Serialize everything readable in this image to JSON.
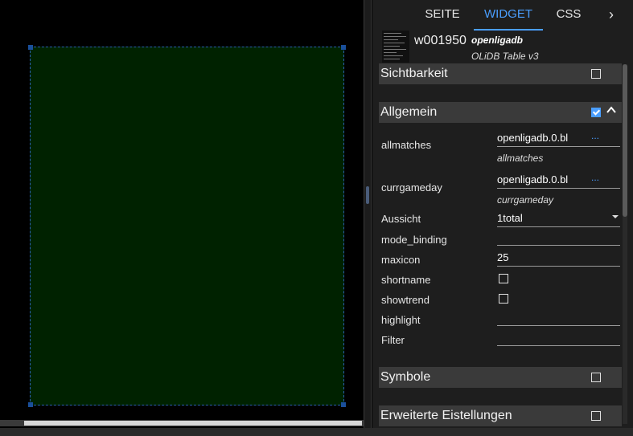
{
  "tabs": {
    "seite": "SEITE",
    "widget": "WIDGET",
    "css": "CSS",
    "next": "›"
  },
  "widget": {
    "id": "w001950",
    "name": "openligadb",
    "desc": "OLiDB Table v3"
  },
  "sections": {
    "sichtbarkeit": "Sichtbarkeit",
    "allgemein": "Allgemein",
    "symbole": "Symbole",
    "erweitert": "Erweiterte Eistellungen"
  },
  "fields": {
    "allmatches": {
      "label": "allmatches",
      "value": "openligadb.0.bl",
      "dots": "...",
      "sub": "allmatches"
    },
    "currgameday": {
      "label": "currgameday",
      "value": "openligadb.0.bl",
      "dots": "...",
      "sub": "currgameday"
    },
    "aussicht": {
      "label": "Aussicht",
      "value": "1total"
    },
    "mode_binding": {
      "label": "mode_binding",
      "value": ""
    },
    "maxicon": {
      "label": "maxicon",
      "value": "25"
    },
    "shortname": {
      "label": "shortname"
    },
    "showtrend": {
      "label": "showtrend"
    },
    "highlight": {
      "label": "highlight",
      "value": ""
    },
    "filter": {
      "label": "Filter",
      "value": ""
    }
  },
  "colors": {
    "accent": "#4a9eff",
    "widget_bg": "#002200"
  }
}
